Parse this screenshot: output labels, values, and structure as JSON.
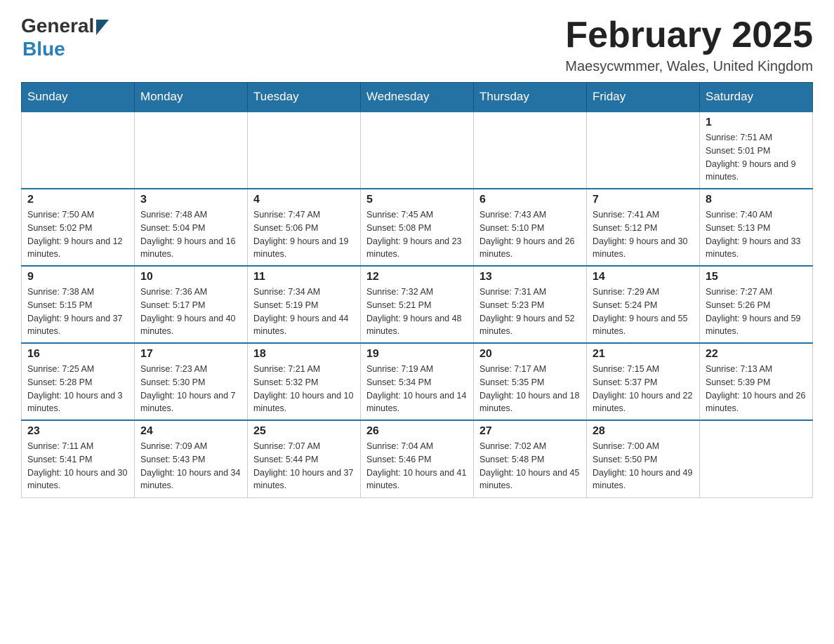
{
  "logo": {
    "general": "General",
    "blue": "Blue"
  },
  "title": {
    "month_year": "February 2025",
    "location": "Maesycwmmer, Wales, United Kingdom"
  },
  "days_of_week": [
    "Sunday",
    "Monday",
    "Tuesday",
    "Wednesday",
    "Thursday",
    "Friday",
    "Saturday"
  ],
  "weeks": [
    {
      "days": [
        {
          "num": "",
          "info": ""
        },
        {
          "num": "",
          "info": ""
        },
        {
          "num": "",
          "info": ""
        },
        {
          "num": "",
          "info": ""
        },
        {
          "num": "",
          "info": ""
        },
        {
          "num": "",
          "info": ""
        },
        {
          "num": "1",
          "info": "Sunrise: 7:51 AM\nSunset: 5:01 PM\nDaylight: 9 hours and 9 minutes."
        }
      ]
    },
    {
      "days": [
        {
          "num": "2",
          "info": "Sunrise: 7:50 AM\nSunset: 5:02 PM\nDaylight: 9 hours and 12 minutes."
        },
        {
          "num": "3",
          "info": "Sunrise: 7:48 AM\nSunset: 5:04 PM\nDaylight: 9 hours and 16 minutes."
        },
        {
          "num": "4",
          "info": "Sunrise: 7:47 AM\nSunset: 5:06 PM\nDaylight: 9 hours and 19 minutes."
        },
        {
          "num": "5",
          "info": "Sunrise: 7:45 AM\nSunset: 5:08 PM\nDaylight: 9 hours and 23 minutes."
        },
        {
          "num": "6",
          "info": "Sunrise: 7:43 AM\nSunset: 5:10 PM\nDaylight: 9 hours and 26 minutes."
        },
        {
          "num": "7",
          "info": "Sunrise: 7:41 AM\nSunset: 5:12 PM\nDaylight: 9 hours and 30 minutes."
        },
        {
          "num": "8",
          "info": "Sunrise: 7:40 AM\nSunset: 5:13 PM\nDaylight: 9 hours and 33 minutes."
        }
      ]
    },
    {
      "days": [
        {
          "num": "9",
          "info": "Sunrise: 7:38 AM\nSunset: 5:15 PM\nDaylight: 9 hours and 37 minutes."
        },
        {
          "num": "10",
          "info": "Sunrise: 7:36 AM\nSunset: 5:17 PM\nDaylight: 9 hours and 40 minutes."
        },
        {
          "num": "11",
          "info": "Sunrise: 7:34 AM\nSunset: 5:19 PM\nDaylight: 9 hours and 44 minutes."
        },
        {
          "num": "12",
          "info": "Sunrise: 7:32 AM\nSunset: 5:21 PM\nDaylight: 9 hours and 48 minutes."
        },
        {
          "num": "13",
          "info": "Sunrise: 7:31 AM\nSunset: 5:23 PM\nDaylight: 9 hours and 52 minutes."
        },
        {
          "num": "14",
          "info": "Sunrise: 7:29 AM\nSunset: 5:24 PM\nDaylight: 9 hours and 55 minutes."
        },
        {
          "num": "15",
          "info": "Sunrise: 7:27 AM\nSunset: 5:26 PM\nDaylight: 9 hours and 59 minutes."
        }
      ]
    },
    {
      "days": [
        {
          "num": "16",
          "info": "Sunrise: 7:25 AM\nSunset: 5:28 PM\nDaylight: 10 hours and 3 minutes."
        },
        {
          "num": "17",
          "info": "Sunrise: 7:23 AM\nSunset: 5:30 PM\nDaylight: 10 hours and 7 minutes."
        },
        {
          "num": "18",
          "info": "Sunrise: 7:21 AM\nSunset: 5:32 PM\nDaylight: 10 hours and 10 minutes."
        },
        {
          "num": "19",
          "info": "Sunrise: 7:19 AM\nSunset: 5:34 PM\nDaylight: 10 hours and 14 minutes."
        },
        {
          "num": "20",
          "info": "Sunrise: 7:17 AM\nSunset: 5:35 PM\nDaylight: 10 hours and 18 minutes."
        },
        {
          "num": "21",
          "info": "Sunrise: 7:15 AM\nSunset: 5:37 PM\nDaylight: 10 hours and 22 minutes."
        },
        {
          "num": "22",
          "info": "Sunrise: 7:13 AM\nSunset: 5:39 PM\nDaylight: 10 hours and 26 minutes."
        }
      ]
    },
    {
      "days": [
        {
          "num": "23",
          "info": "Sunrise: 7:11 AM\nSunset: 5:41 PM\nDaylight: 10 hours and 30 minutes."
        },
        {
          "num": "24",
          "info": "Sunrise: 7:09 AM\nSunset: 5:43 PM\nDaylight: 10 hours and 34 minutes."
        },
        {
          "num": "25",
          "info": "Sunrise: 7:07 AM\nSunset: 5:44 PM\nDaylight: 10 hours and 37 minutes."
        },
        {
          "num": "26",
          "info": "Sunrise: 7:04 AM\nSunset: 5:46 PM\nDaylight: 10 hours and 41 minutes."
        },
        {
          "num": "27",
          "info": "Sunrise: 7:02 AM\nSunset: 5:48 PM\nDaylight: 10 hours and 45 minutes."
        },
        {
          "num": "28",
          "info": "Sunrise: 7:00 AM\nSunset: 5:50 PM\nDaylight: 10 hours and 49 minutes."
        },
        {
          "num": "",
          "info": ""
        }
      ]
    }
  ]
}
